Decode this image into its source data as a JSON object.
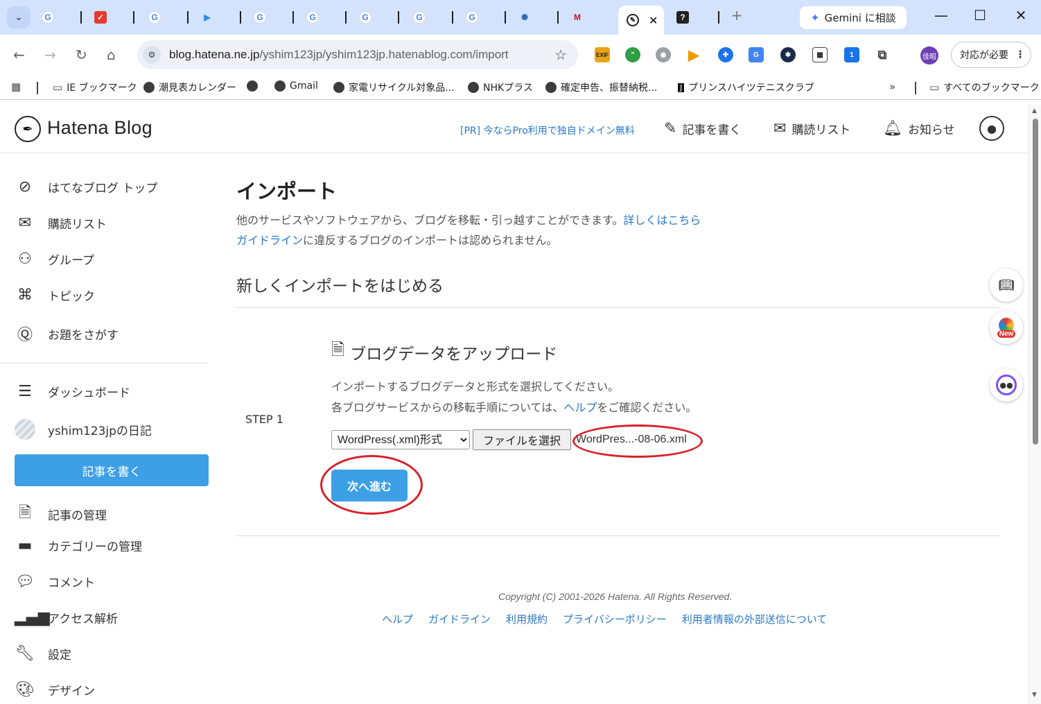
{
  "browser": {
    "gemini_label": "Gemini に相談",
    "url_host": "blog.hatena.ne.jp",
    "url_path": "/yshim123jp/yshim123jp.hatenablog.com/import",
    "profile_initials": "佳昭",
    "action_needed": "対応が必要",
    "extension_badge": "1",
    "bookmarks": [
      "IE ブックマーク",
      "潮見表カレンダー",
      "Gmail",
      "家電リサイクル対象品...",
      "NHKプラス",
      "確定申告、振替納税...",
      "プリンスハイツテニスクラブ"
    ],
    "all_bookmarks": "すべてのブックマーク"
  },
  "header": {
    "logo": "Hatena Blog",
    "pr_link": "[PR] 今ならPro利用で独自ドメイン無料",
    "write": "記事を書く",
    "subscriptions": "購読リスト",
    "notifications": "お知らせ"
  },
  "sidebar": {
    "items": [
      "はてなブログ トップ",
      "購読リスト",
      "グループ",
      "トピック",
      "お題をさがす"
    ],
    "dashboard": "ダッシュボード",
    "blog_name": "yshim123jpの日記",
    "write_button": "記事を書く",
    "manage_items": [
      "記事の管理",
      "カテゴリーの管理",
      "コメント",
      "アクセス解析",
      "設定",
      "デザイン"
    ]
  },
  "main": {
    "title": "インポート",
    "desc_line1": "他のサービスやソフトウェアから、ブログを移転・引っ越すことができます。",
    "desc_link1": "詳しくはこちら",
    "desc_link2": "ガイドライン",
    "desc_line2": "に違反するブログのインポートは認められません。",
    "section_title": "新しくインポートをはじめる",
    "step_label": "STEP 1",
    "upload_title": "ブログデータをアップロード",
    "inst_line1": "インポートするブログデータと形式を選択してください。",
    "inst_line2a": "各ブログサービスからの移転手順については、",
    "inst_link": "ヘルプ",
    "inst_line2b": "をご確認ください。",
    "format_selected": "WordPress(.xml)形式",
    "file_button": "ファイルを選択",
    "file_name": "WordPres...-08-06.xml",
    "next_button": "次へ進む"
  },
  "footer": {
    "copyright": "Copyright (C) 2001-2026 Hatena. All Rights Reserved.",
    "links": [
      "ヘルプ",
      "ガイドライン",
      "利用規約",
      "プライバシーポリシー",
      "利用者情報の外部送信について"
    ]
  },
  "widget": {
    "new_badge": "New"
  },
  "colors": {
    "accent_blue": "#3da0e6",
    "link_blue": "#2a79c7",
    "annotation_red": "#d9202a"
  }
}
